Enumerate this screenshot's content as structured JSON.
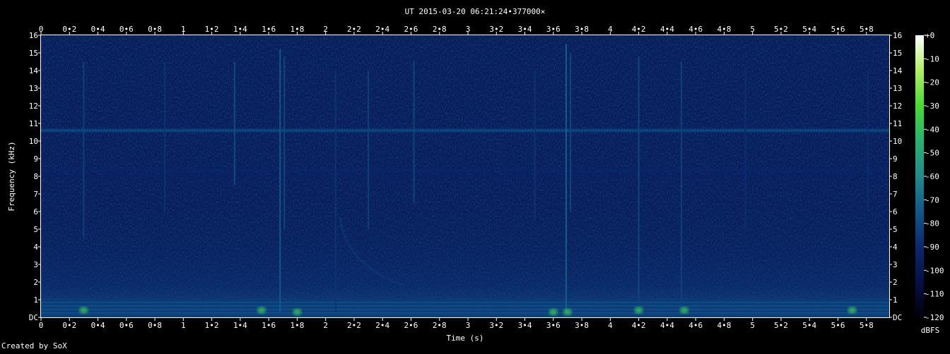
{
  "chart_data": {
    "type": "heatmap",
    "title": "UT 2015-03-20 06:21:24•377000×",
    "xlabel": "Time (s)",
    "ylabel": "Frequency (kHz)",
    "xlim": [
      0,
      5.96
    ],
    "ylim": [
      0,
      16
    ],
    "x_ticks": [
      {
        "value": 0,
        "label": "0"
      },
      {
        "value": 0.2,
        "label": "0•2"
      },
      {
        "value": 0.4,
        "label": "0•4"
      },
      {
        "value": 0.6,
        "label": "0•6"
      },
      {
        "value": 0.8,
        "label": "0•8"
      },
      {
        "value": 1.0,
        "label": "1"
      },
      {
        "value": 1.2,
        "label": "1•2"
      },
      {
        "value": 1.4,
        "label": "1•4"
      },
      {
        "value": 1.6,
        "label": "1•6"
      },
      {
        "value": 1.8,
        "label": "1•8"
      },
      {
        "value": 2.0,
        "label": "2"
      },
      {
        "value": 2.2,
        "label": "2•2"
      },
      {
        "value": 2.4,
        "label": "2•4"
      },
      {
        "value": 2.6,
        "label": "2•6"
      },
      {
        "value": 2.8,
        "label": "2•8"
      },
      {
        "value": 3.0,
        "label": "3"
      },
      {
        "value": 3.2,
        "label": "3•2"
      },
      {
        "value": 3.4,
        "label": "3•4"
      },
      {
        "value": 3.6,
        "label": "3•6"
      },
      {
        "value": 3.8,
        "label": "3•8"
      },
      {
        "value": 4.0,
        "label": "4"
      },
      {
        "value": 4.2,
        "label": "4•2"
      },
      {
        "value": 4.4,
        "label": "4•4"
      },
      {
        "value": 4.6,
        "label": "4•6"
      },
      {
        "value": 4.8,
        "label": "4•8"
      },
      {
        "value": 5.0,
        "label": "5"
      },
      {
        "value": 5.2,
        "label": "5•2"
      },
      {
        "value": 5.4,
        "label": "5•4"
      },
      {
        "value": 5.6,
        "label": "5•6"
      },
      {
        "value": 5.8,
        "label": "5•8"
      }
    ],
    "y_ticks": [
      {
        "value": 0,
        "label": "DC"
      },
      {
        "value": 1,
        "label": "1"
      },
      {
        "value": 2,
        "label": "2"
      },
      {
        "value": 3,
        "label": "3"
      },
      {
        "value": 4,
        "label": "4"
      },
      {
        "value": 5,
        "label": "5"
      },
      {
        "value": 6,
        "label": "6"
      },
      {
        "value": 7,
        "label": "7"
      },
      {
        "value": 8,
        "label": "8"
      },
      {
        "value": 9,
        "label": "9"
      },
      {
        "value": 10,
        "label": "10"
      },
      {
        "value": 11,
        "label": "11"
      },
      {
        "value": 12,
        "label": "12"
      },
      {
        "value": 13,
        "label": "13"
      },
      {
        "value": 14,
        "label": "14"
      },
      {
        "value": 15,
        "label": "15"
      },
      {
        "value": 16,
        "label": "16"
      }
    ],
    "colorbar": {
      "label": "dBFS",
      "range": [
        -120,
        0
      ],
      "ticks": [
        {
          "value": 0,
          "label": "+0"
        },
        {
          "value": -10,
          "label": "-10"
        },
        {
          "value": -20,
          "label": "-20"
        },
        {
          "value": -30,
          "label": "-30"
        },
        {
          "value": -40,
          "label": "-40"
        },
        {
          "value": -50,
          "label": "-50"
        },
        {
          "value": -60,
          "label": "-60"
        },
        {
          "value": -70,
          "label": "-70"
        },
        {
          "value": -80,
          "label": "-80"
        },
        {
          "value": -90,
          "label": "-90"
        },
        {
          "value": -100,
          "label": "-100"
        },
        {
          "value": -110,
          "label": "-110"
        },
        {
          "value": -120,
          "label": "-120"
        }
      ],
      "colors": [
        "#00000a",
        "#050f46",
        "#0a286e",
        "#0f5a8c",
        "#1e8c8c",
        "#28b46e",
        "#46dc32",
        "#b4f064",
        "#ffffff"
      ]
    },
    "background_level_dBFS": -98,
    "horizontal_lines": [
      {
        "freq_khz": 10.6,
        "level_dBFS": -78
      },
      {
        "freq_khz": 8.35,
        "level_dBFS": -92
      },
      {
        "freq_khz": 8.0,
        "level_dBFS": -94
      }
    ],
    "low_band": {
      "from_khz": 0,
      "to_khz": 1.0,
      "level_dBFS": -84
    },
    "impulses": [
      {
        "t": 0.3,
        "f_lo": 4.5,
        "f_hi": 14.5,
        "level_dBFS": -82
      },
      {
        "t": 0.87,
        "f_lo": 6.0,
        "f_hi": 14.5,
        "level_dBFS": -86
      },
      {
        "t": 1.36,
        "f_lo": 7.5,
        "f_hi": 14.5,
        "level_dBFS": -78
      },
      {
        "t": 1.68,
        "f_lo": 0.3,
        "f_hi": 15.2,
        "level_dBFS": -74
      },
      {
        "t": 1.71,
        "f_lo": 5.0,
        "f_hi": 14.8,
        "level_dBFS": -80
      },
      {
        "t": 2.07,
        "f_lo": 0.3,
        "f_hi": 14.0,
        "level_dBFS": -86
      },
      {
        "t": 2.3,
        "f_lo": 5.0,
        "f_hi": 14.0,
        "level_dBFS": -82
      },
      {
        "t": 2.62,
        "f_lo": 6.5,
        "f_hi": 14.5,
        "level_dBFS": -80
      },
      {
        "t": 3.47,
        "f_lo": 5.5,
        "f_hi": 14.0,
        "level_dBFS": -86
      },
      {
        "t": 3.69,
        "f_lo": 0.3,
        "f_hi": 15.5,
        "level_dBFS": -72
      },
      {
        "t": 3.72,
        "f_lo": 6.0,
        "f_hi": 15.0,
        "level_dBFS": -80
      },
      {
        "t": 4.2,
        "f_lo": 0.3,
        "f_hi": 14.8,
        "level_dBFS": -80
      },
      {
        "t": 4.5,
        "f_lo": 0.3,
        "f_hi": 14.5,
        "level_dBFS": -82
      },
      {
        "t": 4.95,
        "f_lo": 5.0,
        "f_hi": 14.0,
        "level_dBFS": -88
      },
      {
        "t": 5.81,
        "f_lo": 6.0,
        "f_hi": 14.0,
        "level_dBFS": -88
      }
    ],
    "whistler": {
      "t_start": 2.1,
      "f_start_khz": 5.6,
      "t_end": 2.56,
      "f_end_khz": 1.8,
      "level_dBFS": -84
    },
    "low_freq_blobs": [
      {
        "t": 0.3,
        "f": 0.4
      },
      {
        "t": 1.55,
        "f": 0.4
      },
      {
        "t": 1.8,
        "f": 0.3
      },
      {
        "t": 3.6,
        "f": 0.3
      },
      {
        "t": 3.7,
        "f": 0.3
      },
      {
        "t": 4.2,
        "f": 0.4
      },
      {
        "t": 4.52,
        "f": 0.4
      },
      {
        "t": 5.7,
        "f": 0.4
      }
    ]
  },
  "footer": {
    "credit": "Created by SoX"
  }
}
